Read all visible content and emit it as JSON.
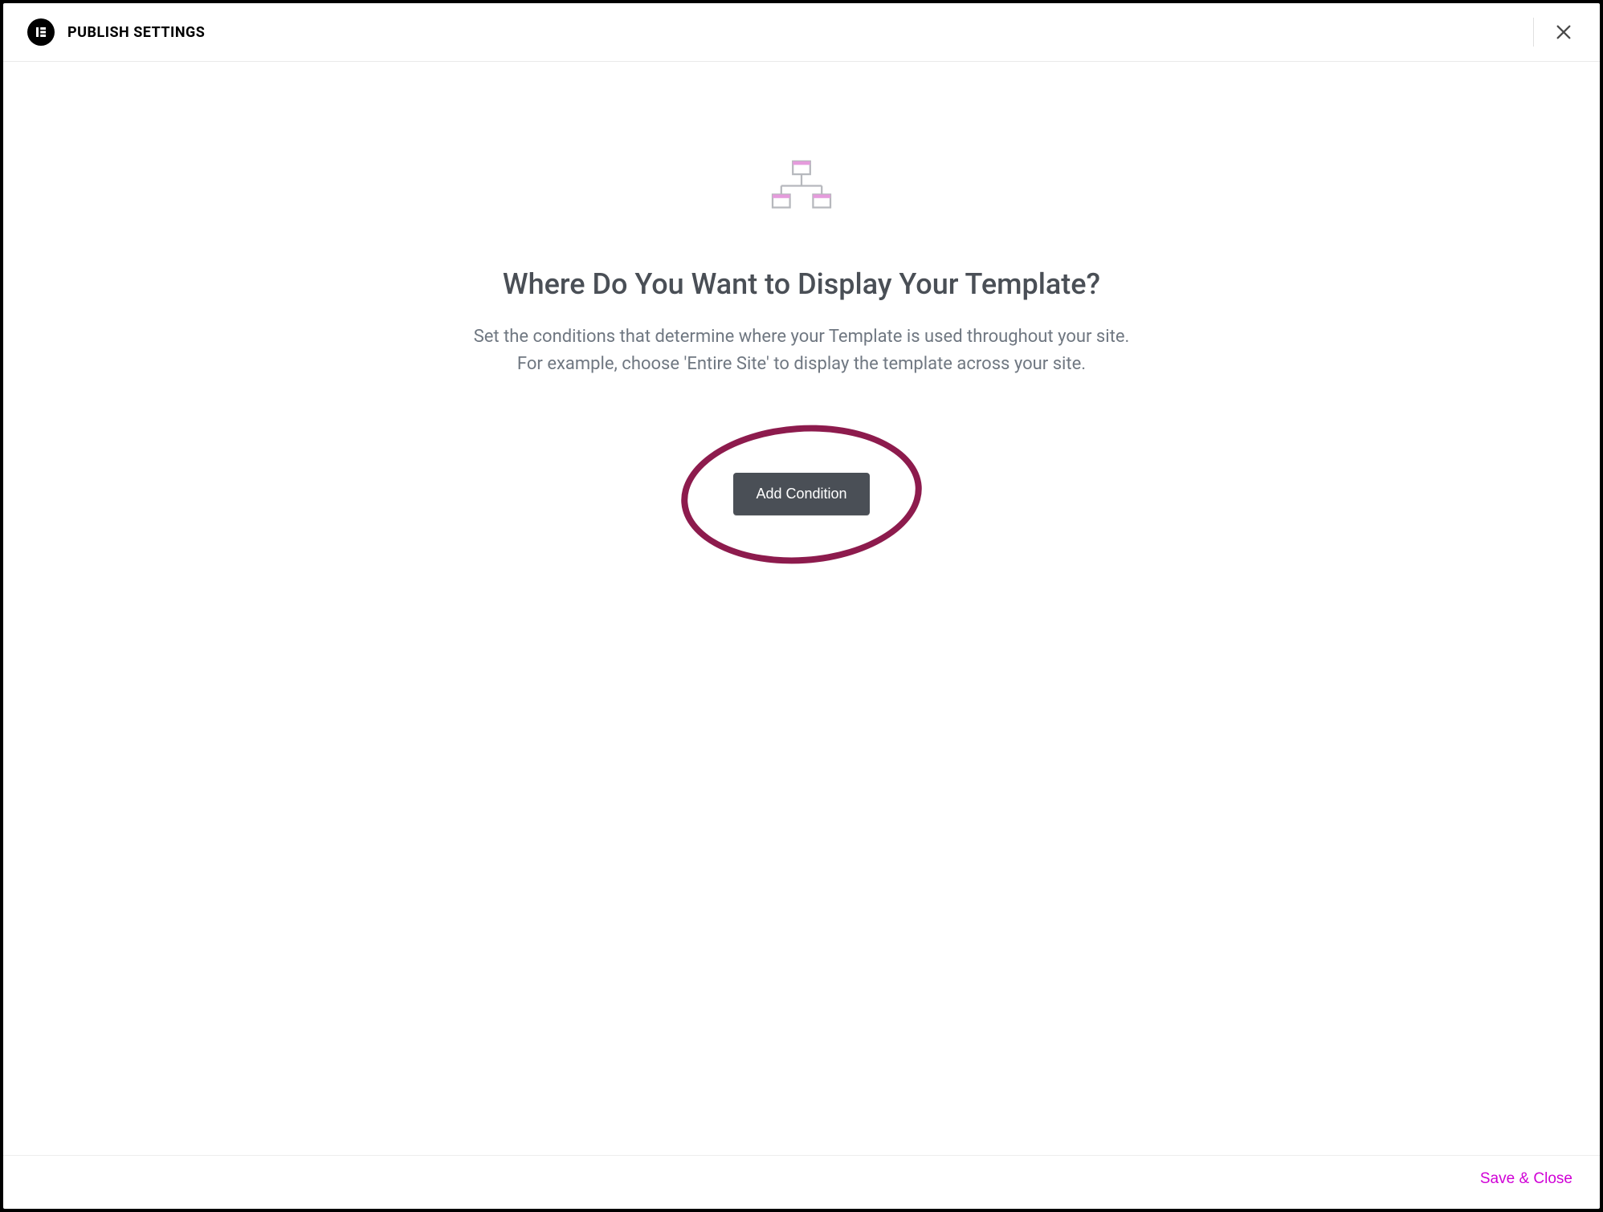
{
  "header": {
    "title": "PUBLISH SETTINGS"
  },
  "main": {
    "heading": "Where Do You Want to Display Your Template?",
    "description_line1": "Set the conditions that determine where your Template is used throughout your site.",
    "description_line2": "For example, choose 'Entire Site' to display the template across your site.",
    "add_button_label": "Add Condition"
  },
  "footer": {
    "save_close_label": "Save & Close"
  }
}
